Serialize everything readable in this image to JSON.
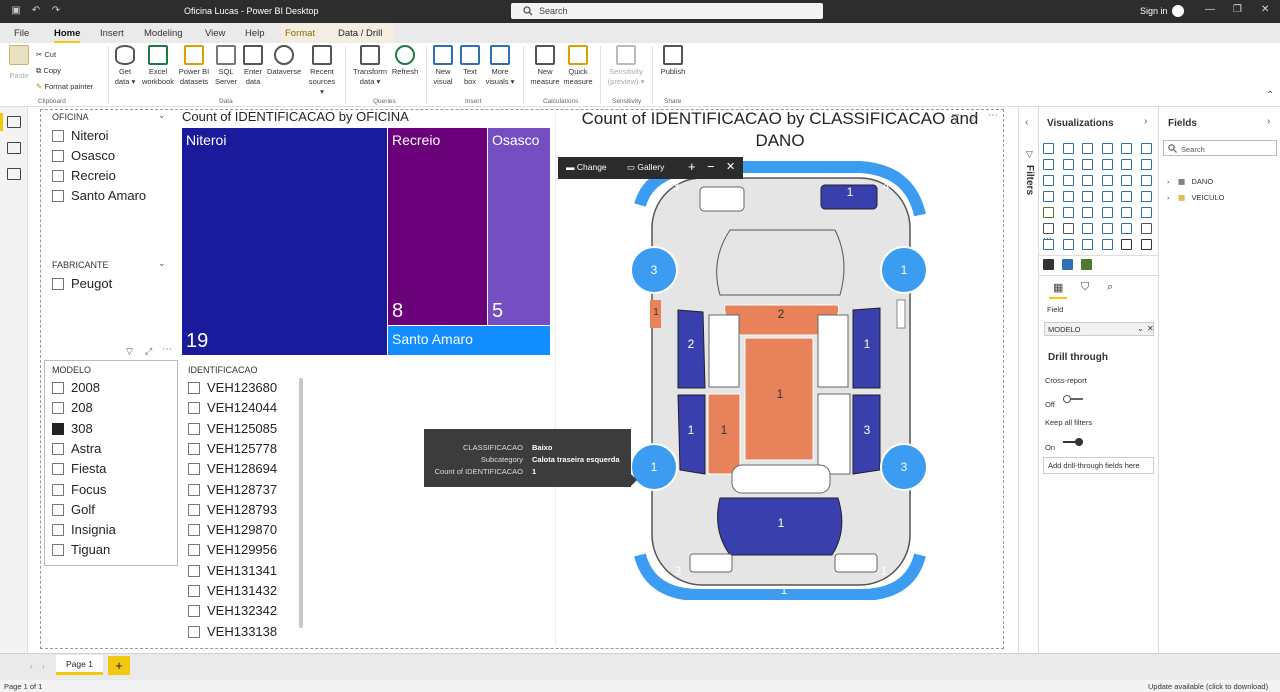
{
  "window": {
    "title": "Oficina Lucas - Power BI Desktop",
    "search_placeholder": "Search",
    "signin": "Sign in"
  },
  "tabs": [
    "File",
    "Home",
    "Insert",
    "Modeling",
    "View",
    "Help",
    "Format",
    "Data / Drill"
  ],
  "ribbon": {
    "clipboard": {
      "paste": "Paste",
      "cut": "Cut",
      "copy": "Copy",
      "format_painter": "Format painter",
      "group": "Clipboard"
    },
    "data": {
      "get_data_1": "Get",
      "get_data_2": "data ▾",
      "excel_1": "Excel",
      "excel_2": "workbook",
      "pbi_1": "Power BI",
      "pbi_2": "datasets",
      "sql_1": "SQL",
      "sql_2": "Server",
      "enter_1": "Enter",
      "enter_2": "data",
      "dataverse": "Dataverse",
      "recent_1": "Recent",
      "recent_2": "sources ▾",
      "group": "Data"
    },
    "queries": {
      "transform_1": "Transform",
      "transform_2": "data ▾",
      "refresh": "Refresh",
      "group": "Queries"
    },
    "insert": {
      "new_visual_1": "New",
      "new_visual_2": "visual",
      "text_box_1": "Text",
      "text_box_2": "box",
      "more_visuals_1": "More",
      "more_visuals_2": "visuals ▾",
      "group": "Insert"
    },
    "calculations": {
      "new_measure_1": "New",
      "new_measure_2": "measure",
      "quick_measure_1": "Quick",
      "quick_measure_2": "measure",
      "group": "Calculations"
    },
    "sensitivity": {
      "label_1": "Sensitivity",
      "label_2": "(preview) ▾",
      "group": "Sensitivity"
    },
    "share": {
      "publish": "Publish",
      "group": "Share"
    }
  },
  "slicer_oficina": {
    "header": "OFICINA",
    "items": [
      "Niteroi",
      "Osasco",
      "Recreio",
      "Santo Amaro"
    ]
  },
  "slicer_fabricante": {
    "header": "FABRICANTE",
    "items": [
      "Peugot"
    ]
  },
  "slicer_modelo": {
    "header": "MODELO",
    "items": [
      "2008",
      "208",
      "308",
      "Astra",
      "Fiesta",
      "Focus",
      "Golf",
      "Insignia",
      "Tiguan"
    ],
    "selected": "308"
  },
  "slicer_identificacao": {
    "header": "IDENTIFICACAO",
    "items": [
      "VEH123680",
      "VEH124044",
      "VEH125085",
      "VEH125778",
      "VEH128694",
      "VEH128737",
      "VEH128793",
      "VEH129870",
      "VEH129956",
      "VEH131341",
      "VEH131432",
      "VEH132342",
      "VEH133138"
    ]
  },
  "treemap": {
    "title": "Count of IDENTIFICACAO by OFICINA",
    "cells": [
      {
        "label": "Niteroi",
        "value": "19",
        "color": "#1a1a9c"
      },
      {
        "label": "Recreio",
        "value": "8",
        "color": "#6b007b"
      },
      {
        "label": "Osasco",
        "value": "5",
        "color": "#744ec2"
      },
      {
        "label": "Santo Amaro",
        "value": "",
        "color": "#118dff"
      }
    ]
  },
  "car_visual": {
    "title_line1": "Count of IDENTIFICACAO by CLASSIFICACAO and",
    "title_line2": "DANO",
    "labels": {
      "front_right_glass": "1",
      "right_mirror_front": "3",
      "right_mirror_front_b": "1",
      "top_left_wheel": "3",
      "top_right_wheel": "1",
      "hood_front": "2",
      "left_door_front": "2",
      "right_door_front": "1",
      "roof": "1",
      "left_door_rear": "1",
      "left_mid": "1",
      "right_door_rear": "3",
      "bottom_left_wheel": "1",
      "bottom_right_wheel": "3",
      "rear_glass": "1",
      "small_left": "1",
      "corner_tl": "3",
      "corner_tr": "4",
      "corner_bl": "3",
      "corner_br": "1",
      "bottom_arc": "1"
    }
  },
  "chart_toolbar": {
    "change": "Change",
    "gallery": "Gallery"
  },
  "tooltip": {
    "rows": [
      {
        "key": "CLASSIFICACAO",
        "value": "Baixo"
      },
      {
        "key": "Subcategory",
        "value": "Calota traseira esquerda"
      },
      {
        "key": "Count of IDENTIFICACAO",
        "value": "1"
      }
    ]
  },
  "filters_pane": {
    "label": "Filters"
  },
  "visualizations": {
    "title": "Visualizations",
    "field_label": "Field",
    "field_value": "MODELO",
    "drill_through": "Drill through",
    "cross_report": "Cross-report",
    "cross_report_state": "Off",
    "keep_filters": "Keep all filters",
    "keep_filters_state": "On",
    "add_fields": "Add drill-through fields here"
  },
  "fields": {
    "title": "Fields",
    "search_placeholder": "Search",
    "tables": [
      "DANO",
      "VEICULO"
    ]
  },
  "pages": {
    "page1": "Page 1",
    "add": "+"
  },
  "status": {
    "left": "Page 1 of 1",
    "right": "Update available (click to download)"
  }
}
